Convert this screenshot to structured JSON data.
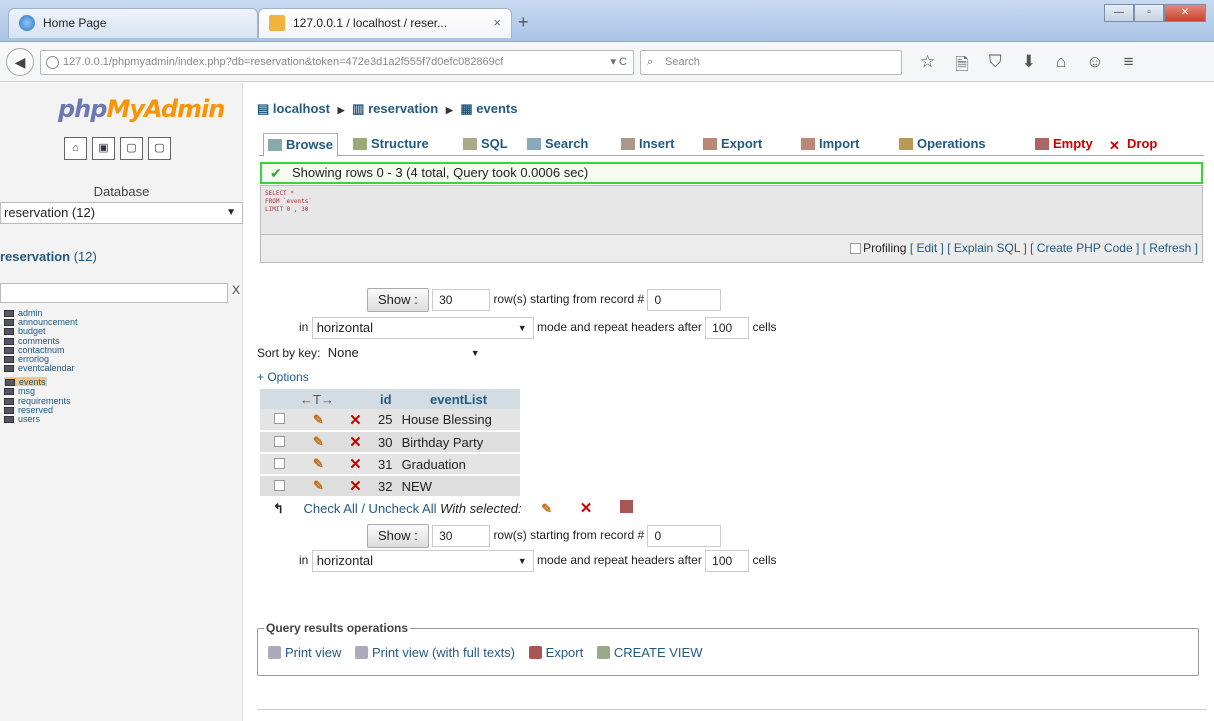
{
  "browser": {
    "tabs": [
      {
        "title": "Home Page",
        "close": "×"
      },
      {
        "title": "127.0.0.1 / localhost / reser...",
        "close": "×"
      }
    ],
    "new_tab": "+",
    "window_buttons": {
      "minimize": "—",
      "maximize": "▫",
      "close": "✕"
    },
    "url": "127.0.0.1/phpmyadmin/index.php?db=reservation&token=472e3d1a2f555f7d0efc082869cf",
    "search_placeholder": "Search",
    "nav_icons": [
      "☆",
      "🗎",
      "⛉",
      "⬇",
      "⌂",
      "☺",
      "≡"
    ]
  },
  "sidebar": {
    "logo_php": "php",
    "logo_myadmin": "MyAdmin",
    "database_label": "Database",
    "database_selected": "reservation (12)",
    "db_heading": "reservation",
    "db_count": "(12)",
    "filter_clear": "X",
    "tables": [
      "admin",
      "announcement",
      "budget",
      "comments",
      "contactnum",
      "errorlog",
      "eventcalendar",
      "events",
      "msg",
      "requirements",
      "reserved",
      "users"
    ],
    "selected_table": "events"
  },
  "main": {
    "breadcrumb": {
      "server": "localhost",
      "database": "reservation",
      "table": "events"
    },
    "tabs": [
      "Browse",
      "Structure",
      "SQL",
      "Search",
      "Insert",
      "Export",
      "Import",
      "Operations",
      "Empty",
      "Drop"
    ],
    "message": "Showing rows 0 - 3 (4 total, Query took 0.0006 sec)",
    "sql_lines": [
      "SELECT *",
      "FROM `events`",
      "LIMIT 0 , 30"
    ],
    "profiling": {
      "label": "Profiling",
      "edit": "[ Edit ]",
      "explain": "[ Explain SQL ]",
      "create_php": "[ Create PHP Code ]",
      "refresh": "[ Refresh ]"
    },
    "nav": {
      "show_button": "Show :",
      "rows_value": "30",
      "starting_text": "row(s) starting from record #",
      "start_value": "0",
      "in_text": "in",
      "mode": "horizontal",
      "mode_text": "mode and repeat headers after",
      "repeat_value": "100",
      "cells_text": "cells"
    },
    "sort_label": "Sort by key:",
    "sort_value": "None",
    "options": "+ Options",
    "grid": {
      "arrows": "←T→",
      "columns": [
        "id",
        "eventList"
      ],
      "rows": [
        {
          "id": "25",
          "eventList": "House Blessing"
        },
        {
          "id": "30",
          "eventList": "Birthday Party"
        },
        {
          "id": "31",
          "eventList": "Graduation"
        },
        {
          "id": "32",
          "eventList": "NEW"
        }
      ]
    },
    "check_all": "Check All / Uncheck All",
    "with_selected": "With selected:",
    "qro": {
      "legend": "Query results operations",
      "print": "Print view",
      "print_full": "Print view (with full texts)",
      "export": "Export",
      "create_view": "CREATE VIEW"
    }
  }
}
